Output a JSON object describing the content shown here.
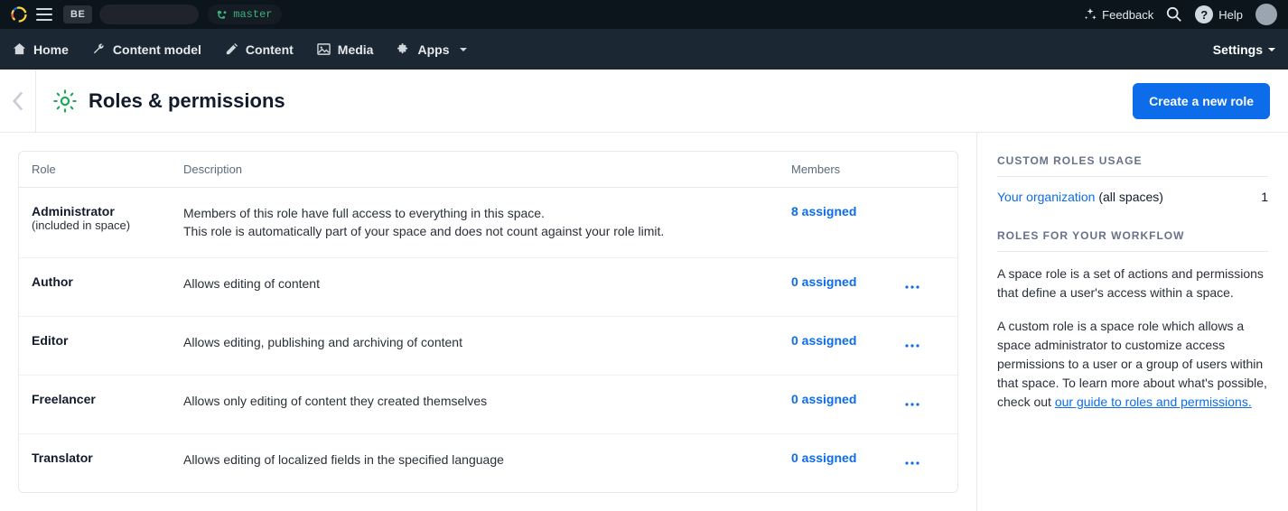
{
  "topbar": {
    "space_badge": "BE",
    "branch": "master",
    "feedback": "Feedback",
    "help": "Help"
  },
  "nav": {
    "home": "Home",
    "content_model": "Content model",
    "content": "Content",
    "media": "Media",
    "apps": "Apps",
    "settings": "Settings"
  },
  "header": {
    "title": "Roles & permissions",
    "create_button": "Create a new role"
  },
  "table": {
    "headers": {
      "role": "Role",
      "description": "Description",
      "members": "Members"
    },
    "rows": [
      {
        "name": "Administrator",
        "sub": "(included in space)",
        "desc_line1": "Members of this role have full access to everything in this space.",
        "desc_line2": "This role is automatically part of your space and does not count against your role limit.",
        "members": "8 assigned",
        "has_actions": false
      },
      {
        "name": "Author",
        "desc_line1": "Allows editing of content",
        "members": "0 assigned",
        "has_actions": true
      },
      {
        "name": "Editor",
        "desc_line1": "Allows editing, publishing and archiving of content",
        "members": "0 assigned",
        "has_actions": true
      },
      {
        "name": "Freelancer",
        "desc_line1": "Allows only editing of content they created themselves",
        "members": "0 assigned",
        "has_actions": true
      },
      {
        "name": "Translator",
        "desc_line1": "Allows editing of localized fields in the specified language",
        "members": "0 assigned",
        "has_actions": true
      }
    ]
  },
  "sidebar": {
    "usage_heading": "CUSTOM ROLES USAGE",
    "org_link": "Your organization",
    "org_suffix": " (all spaces)",
    "org_count": "1",
    "workflow_heading": "ROLES FOR YOUR WORKFLOW",
    "para1": "A space role is a set of actions and permissions that define a user's access within a space.",
    "para2_prefix": "A custom role is a space role which allows a space administrator to customize access permissions to a user or a group of users within that space. To learn more about what's possible, check out ",
    "para2_link": "our guide to roles and permissions."
  }
}
